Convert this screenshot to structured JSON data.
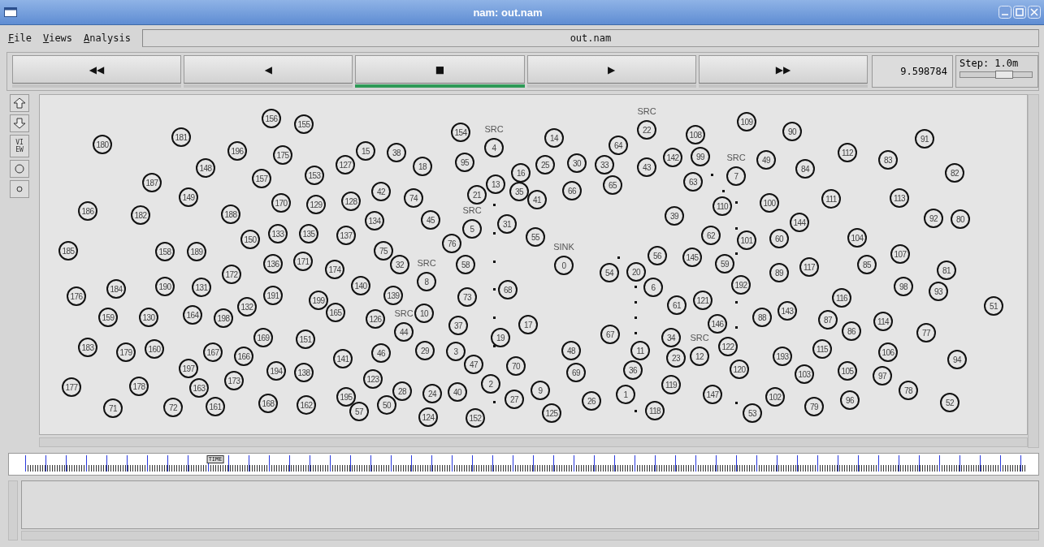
{
  "window": {
    "title": "nam: out.nam"
  },
  "menu": [
    {
      "label": "File"
    },
    {
      "label": "Views"
    },
    {
      "label": "Analysis"
    }
  ],
  "file_field": "out.nam",
  "playback": [
    {
      "symbol": "◀◀",
      "selected": false
    },
    {
      "symbol": "◀",
      "selected": false
    },
    {
      "symbol": "■",
      "selected": true
    },
    {
      "symbol": "▶",
      "selected": false
    },
    {
      "symbol": "▶▶",
      "selected": false
    }
  ],
  "time": "9.598784",
  "step": {
    "label": "Step: 1.0m",
    "level": 0.6
  },
  "tools": {
    "view": "VIEW"
  },
  "nodes": [
    {
      "id": "156"
    },
    {
      "id": "155"
    },
    {
      "id": "180"
    },
    {
      "id": "181"
    },
    {
      "id": "196"
    },
    {
      "id": "175"
    },
    {
      "id": "15"
    },
    {
      "id": "38"
    },
    {
      "id": "154"
    },
    {
      "id": "4",
      "label": "SRC"
    },
    {
      "id": "14"
    },
    {
      "id": "22",
      "label": "SRC"
    },
    {
      "id": "108"
    },
    {
      "id": "109"
    },
    {
      "id": "90"
    },
    {
      "id": "91"
    },
    {
      "id": "148"
    },
    {
      "id": "157"
    },
    {
      "id": "153"
    },
    {
      "id": "127"
    },
    {
      "id": "18"
    },
    {
      "id": "95"
    },
    {
      "id": "16"
    },
    {
      "id": "25"
    },
    {
      "id": "30"
    },
    {
      "id": "64"
    },
    {
      "id": "33"
    },
    {
      "id": "43"
    },
    {
      "id": "142"
    },
    {
      "id": "99"
    },
    {
      "id": "7",
      "label": "SRC"
    },
    {
      "id": "49"
    },
    {
      "id": "84"
    },
    {
      "id": "112"
    },
    {
      "id": "83"
    },
    {
      "id": "186"
    },
    {
      "id": "187"
    },
    {
      "id": "182"
    },
    {
      "id": "149"
    },
    {
      "id": "188"
    },
    {
      "id": "170"
    },
    {
      "id": "129"
    },
    {
      "id": "128"
    },
    {
      "id": "42"
    },
    {
      "id": "134"
    },
    {
      "id": "74"
    },
    {
      "id": "45"
    },
    {
      "id": "21"
    },
    {
      "id": "5",
      "label": "SRC"
    },
    {
      "id": "13"
    },
    {
      "id": "35"
    },
    {
      "id": "31"
    },
    {
      "id": "41"
    },
    {
      "id": "66"
    },
    {
      "id": "65"
    },
    {
      "id": "63"
    },
    {
      "id": "39"
    },
    {
      "id": "110"
    },
    {
      "id": "100"
    },
    {
      "id": "144"
    },
    {
      "id": "111"
    },
    {
      "id": "113"
    },
    {
      "id": "92"
    },
    {
      "id": "82"
    },
    {
      "id": "80"
    },
    {
      "id": "185"
    },
    {
      "id": "158"
    },
    {
      "id": "189"
    },
    {
      "id": "150"
    },
    {
      "id": "133"
    },
    {
      "id": "135"
    },
    {
      "id": "137"
    },
    {
      "id": "76"
    },
    {
      "id": "55"
    },
    {
      "id": "62"
    },
    {
      "id": "101"
    },
    {
      "id": "60"
    },
    {
      "id": "104"
    },
    {
      "id": "172"
    },
    {
      "id": "136"
    },
    {
      "id": "171"
    },
    {
      "id": "174"
    },
    {
      "id": "75"
    },
    {
      "id": "32"
    },
    {
      "id": "8",
      "label": "SRC"
    },
    {
      "id": "58"
    },
    {
      "id": "0",
      "label": "SINK"
    },
    {
      "id": "54"
    },
    {
      "id": "20"
    },
    {
      "id": "56"
    },
    {
      "id": "145"
    },
    {
      "id": "59"
    },
    {
      "id": "89"
    },
    {
      "id": "117"
    },
    {
      "id": "85"
    },
    {
      "id": "107"
    },
    {
      "id": "81"
    },
    {
      "id": "176"
    },
    {
      "id": "184"
    },
    {
      "id": "190"
    },
    {
      "id": "131"
    },
    {
      "id": "191"
    },
    {
      "id": "140"
    },
    {
      "id": "68"
    },
    {
      "id": "6"
    },
    {
      "id": "192"
    },
    {
      "id": "98"
    },
    {
      "id": "93"
    },
    {
      "id": "159"
    },
    {
      "id": "130"
    },
    {
      "id": "164"
    },
    {
      "id": "198"
    },
    {
      "id": "132"
    },
    {
      "id": "199"
    },
    {
      "id": "165"
    },
    {
      "id": "139"
    },
    {
      "id": "126"
    },
    {
      "id": "44",
      "label": "SRC"
    },
    {
      "id": "10"
    },
    {
      "id": "73"
    },
    {
      "id": "37"
    },
    {
      "id": "17"
    },
    {
      "id": "61"
    },
    {
      "id": "121"
    },
    {
      "id": "146"
    },
    {
      "id": "88"
    },
    {
      "id": "143"
    },
    {
      "id": "116"
    },
    {
      "id": "87"
    },
    {
      "id": "86"
    },
    {
      "id": "114"
    },
    {
      "id": "77"
    },
    {
      "id": "51"
    },
    {
      "id": "183"
    },
    {
      "id": "177"
    },
    {
      "id": "179"
    },
    {
      "id": "160"
    },
    {
      "id": "71"
    },
    {
      "id": "178"
    },
    {
      "id": "197"
    },
    {
      "id": "72"
    },
    {
      "id": "167"
    },
    {
      "id": "163"
    },
    {
      "id": "161"
    },
    {
      "id": "166"
    },
    {
      "id": "173"
    },
    {
      "id": "169"
    },
    {
      "id": "194"
    },
    {
      "id": "168"
    },
    {
      "id": "151"
    },
    {
      "id": "138"
    },
    {
      "id": "162"
    },
    {
      "id": "141"
    },
    {
      "id": "195"
    },
    {
      "id": "123"
    },
    {
      "id": "57"
    },
    {
      "id": "46"
    },
    {
      "id": "50"
    },
    {
      "id": "28"
    },
    {
      "id": "29"
    },
    {
      "id": "24"
    },
    {
      "id": "124"
    },
    {
      "id": "3"
    },
    {
      "id": "47"
    },
    {
      "id": "40"
    },
    {
      "id": "2"
    },
    {
      "id": "152"
    },
    {
      "id": "19"
    },
    {
      "id": "70"
    },
    {
      "id": "27"
    },
    {
      "id": "9"
    },
    {
      "id": "48"
    },
    {
      "id": "125"
    },
    {
      "id": "69"
    },
    {
      "id": "67"
    },
    {
      "id": "26"
    },
    {
      "id": "11"
    },
    {
      "id": "36"
    },
    {
      "id": "1"
    },
    {
      "id": "34"
    },
    {
      "id": "119"
    },
    {
      "id": "118"
    },
    {
      "id": "23"
    },
    {
      "id": "12",
      "label": "SRC"
    },
    {
      "id": "122"
    },
    {
      "id": "147"
    },
    {
      "id": "120"
    },
    {
      "id": "53"
    },
    {
      "id": "193"
    },
    {
      "id": "102"
    },
    {
      "id": "115"
    },
    {
      "id": "103"
    },
    {
      "id": "79"
    },
    {
      "id": "105"
    },
    {
      "id": "96"
    },
    {
      "id": "106"
    },
    {
      "id": "97"
    },
    {
      "id": "78"
    },
    {
      "id": "94"
    },
    {
      "id": "52"
    }
  ],
  "timeline": {
    "marker": "TIME",
    "level": 0.19
  }
}
